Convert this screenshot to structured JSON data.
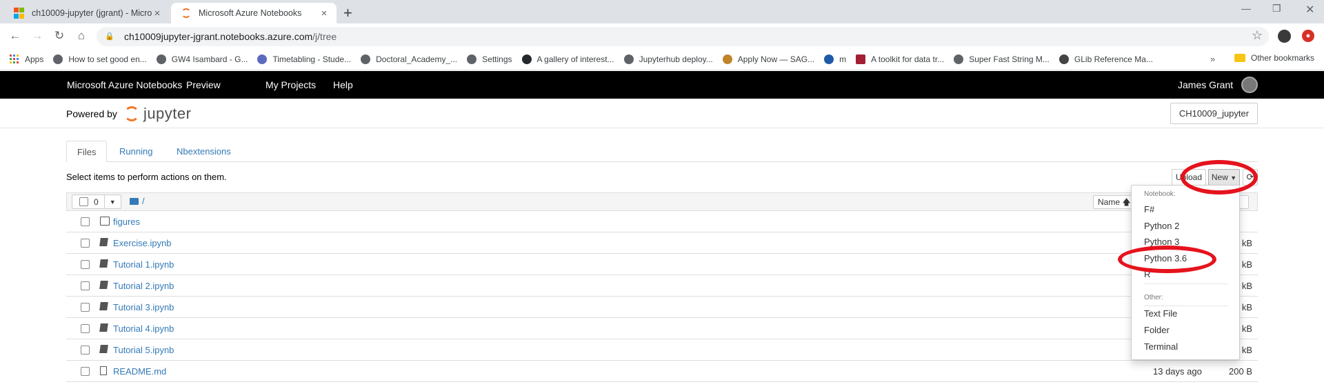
{
  "browser": {
    "tabs": [
      {
        "title": "ch10009-jupyter (jgrant) - Micro",
        "active": false
      },
      {
        "title": "Microsoft Azure Notebooks",
        "active": true
      }
    ],
    "url_host": "ch10009jupyter-jgrant.notebooks.azure.com",
    "url_path": "/j/tree",
    "bookmarks": [
      "Apps",
      "How to set good en...",
      "GW4 Isambard - G...",
      "Timetabling - Stude...",
      "Doctoral_Academy_...",
      "Settings",
      "A gallery of interest...",
      "Jupyterhub deploy...",
      "Apply Now — SAG...",
      "m",
      "A toolkit for data tr...",
      "Super Fast String M...",
      "GLib Reference Ma..."
    ],
    "bookmarks_more": "»",
    "other_bookmarks": "Other bookmarks"
  },
  "azure": {
    "brand": "Microsoft Azure Notebooks",
    "preview": "Preview",
    "my_projects": "My Projects",
    "help": "Help",
    "user": "James Grant"
  },
  "jupyter": {
    "powered_by": "Powered by",
    "logo_text": "jupyter",
    "project_button": "CH10009_jupyter",
    "tabs": [
      "Files",
      "Running",
      "Nbextensions"
    ],
    "select_hint": "Select items to perform actions on them.",
    "upload": "Upload",
    "new": "New",
    "selected_count": "0",
    "breadcrumb": "/",
    "sort_name": "Name",
    "sort_size": "ze",
    "files": [
      {
        "type": "folder",
        "name": "figures",
        "modified": "",
        "size": ""
      },
      {
        "type": "notebook",
        "name": "Exercise.ipynb",
        "modified": "",
        "size": "kB"
      },
      {
        "type": "notebook",
        "name": "Tutorial 1.ipynb",
        "modified": "",
        "size": "kB"
      },
      {
        "type": "notebook",
        "name": "Tutorial 2.ipynb",
        "modified": "",
        "size": "kB"
      },
      {
        "type": "notebook",
        "name": "Tutorial 3.ipynb",
        "modified": "",
        "size": "kB"
      },
      {
        "type": "notebook",
        "name": "Tutorial 4.ipynb",
        "modified": "",
        "size": "kB"
      },
      {
        "type": "notebook",
        "name": "Tutorial 5.ipynb",
        "modified": "",
        "size": "kB"
      },
      {
        "type": "file",
        "name": "README.md",
        "modified": "13 days ago",
        "size": "200 B"
      }
    ],
    "new_menu": {
      "notebook_header": "Notebook:",
      "notebook_items": [
        "F#",
        "Python 2",
        "Python 3",
        "Python 3.6",
        "R"
      ],
      "other_header": "Other:",
      "other_items": [
        "Text File",
        "Folder",
        "Terminal"
      ]
    }
  },
  "colors": {
    "annotation_red": "#e5131d",
    "link_blue": "#337ab7",
    "jupyter_orange": "#f37626"
  }
}
